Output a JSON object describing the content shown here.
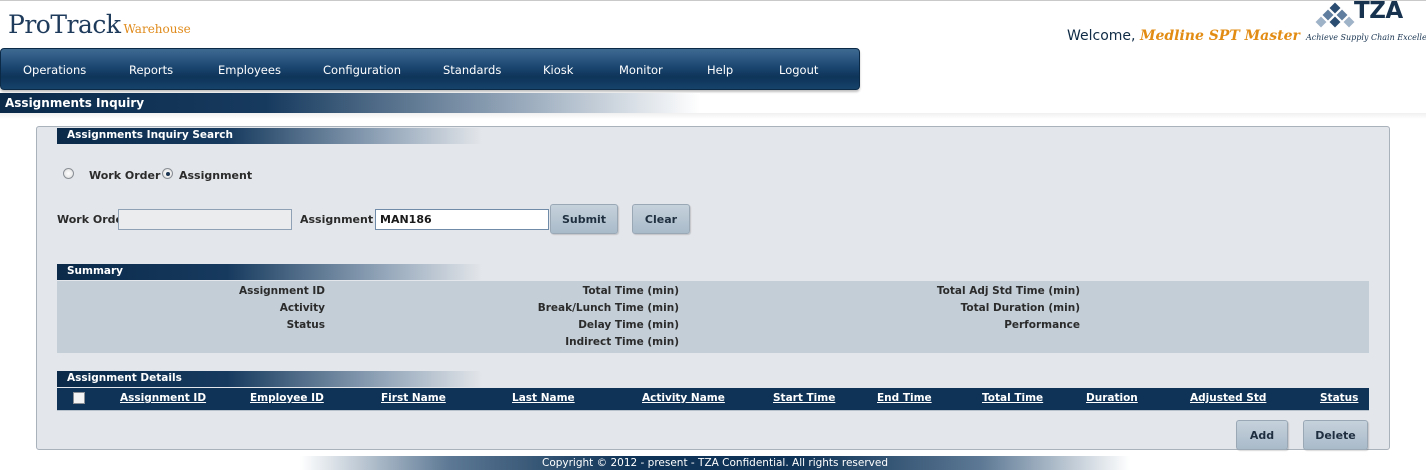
{
  "header": {
    "logo_main": "ProTrack",
    "logo_sub": "Warehouse",
    "welcome_prefix": "Welcome, ",
    "welcome_user": "Medline SPT Master",
    "brand_name": "TZA",
    "brand_tagline": "Achieve Supply Chain Excellence"
  },
  "nav": {
    "items": [
      "Operations",
      "Reports",
      "Employees",
      "Configuration",
      "Standards",
      "Kiosk",
      "Monitor",
      "Help",
      "Logout"
    ]
  },
  "page": {
    "title": "Assignments Inquiry"
  },
  "search": {
    "section_title": "Assignments Inquiry Search",
    "radio_work_order": "Work Order",
    "radio_assignment": "Assignment",
    "selected_mode": "Assignment",
    "work_order_label": "Work Order",
    "work_order_value": "",
    "assignment_id_label": "Assignment ID",
    "assignment_id_value": "MAN186",
    "submit_label": "Submit",
    "clear_label": "Clear"
  },
  "summary": {
    "section_title": "Summary",
    "col1": [
      "Assignment ID",
      "Activity",
      "Status"
    ],
    "col2": [
      "Total Time (min)",
      "Break/Lunch Time (min)",
      "Delay Time (min)",
      "Indirect Time (min)"
    ],
    "col3": [
      "Total Adj Std Time (min)",
      "Total Duration (min)",
      "Performance"
    ]
  },
  "details": {
    "section_title": "Assignment Details",
    "columns": [
      "Assignment ID",
      "Employee ID",
      "First Name",
      "Last Name",
      "Activity Name",
      "Start Time",
      "End Time",
      "Total Time",
      "Duration",
      "Adjusted Std",
      "Status"
    ],
    "rows": [],
    "add_label": "Add",
    "delete_label": "Delete"
  },
  "footer": {
    "copyright": "Copyright © 2012 - present - TZA Confidential. All rights reserved"
  },
  "colors": {
    "nav_bg": "#1b4670",
    "header_dark": "#0f3356",
    "accent_orange": "#e38c14",
    "panel_bg": "#e3e6ea"
  },
  "icons": {
    "brand_mark": "tza-diamonds-icon"
  }
}
